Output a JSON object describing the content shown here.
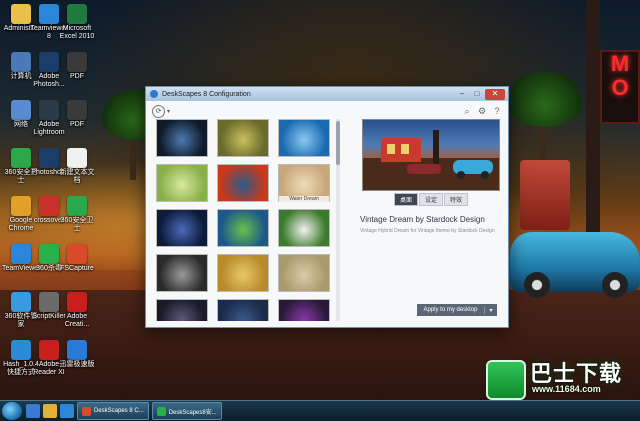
{
  "desktop_icons": [
    {
      "label": "Administr...",
      "icon": "folder-user-icon",
      "color": "#e8c04a"
    },
    {
      "label": "Teamviewer 8",
      "icon": "teamviewer-icon",
      "color": "#2a86d8"
    },
    {
      "label": "Microsoft Excel 2010",
      "icon": "excel-icon",
      "color": "#1e7a3e"
    },
    {
      "label": "计算机",
      "icon": "computer-icon",
      "color": "#4a78b8"
    },
    {
      "label": "Adobe Photosh...",
      "icon": "photoshop-icon",
      "color": "#1b3d6a"
    },
    {
      "label": "PDF",
      "icon": "pdf-icon",
      "color": "#3a3a3a"
    },
    {
      "label": "网络",
      "icon": "network-icon",
      "color": "#5a8ad0"
    },
    {
      "label": "Adobe Lightroom",
      "icon": "lightroom-icon",
      "color": "#2a3a48"
    },
    {
      "label": "PDF",
      "icon": "pdf-icon",
      "color": "#3a3a3a"
    },
    {
      "label": "360安全卫士",
      "icon": "360-icon",
      "color": "#2aa84a"
    },
    {
      "label": "Photosho...",
      "icon": "photoshop-icon",
      "color": "#1b3d6a"
    },
    {
      "label": "新建文本文档",
      "icon": "text-file-icon",
      "color": "#f0f0f0"
    },
    {
      "label": "Google Chrome",
      "icon": "chrome-icon",
      "color": "#e0a02a"
    },
    {
      "label": "crossover",
      "icon": "crossover-icon",
      "color": "#c8322a"
    },
    {
      "label": "360安全卫士",
      "icon": "360-icon",
      "color": "#2aa84a"
    },
    {
      "label": "TeamViewer",
      "icon": "teamviewer-icon",
      "color": "#2a86d8"
    },
    {
      "label": "360杀毒",
      "icon": "360-antivirus-icon",
      "color": "#2ab04a"
    },
    {
      "label": "FSCapture",
      "icon": "fscapture-icon",
      "color": "#d84a2a"
    },
    {
      "label": "360软件管家",
      "icon": "360-soft-icon",
      "color": "#3a9ae0"
    },
    {
      "label": "ScriptKiller",
      "icon": "script-icon",
      "color": "#6a6a6a"
    },
    {
      "label": "Adobe Creati...",
      "icon": "adobe-cc-icon",
      "color": "#c81e1e"
    },
    {
      "label": "Hash_1.0.4 快捷方式",
      "icon": "hash-icon",
      "color": "#2a8ad8"
    },
    {
      "label": "Adobe Reader XI",
      "icon": "reader-icon",
      "color": "#c81e1e"
    },
    {
      "label": "迅雷极速版",
      "icon": "thunder-icon",
      "color": "#2a7ad8"
    }
  ],
  "dialog": {
    "title": "DeskScapes 8 Configuration",
    "minimize": "–",
    "maximize": "□",
    "close": "✕",
    "thumbnails": [
      {
        "caption": "",
        "color": "#101a2a",
        "accent": "#4a7ab0"
      },
      {
        "caption": "",
        "color": "#6a6a2a",
        "accent": "#c8c060"
      },
      {
        "caption": "",
        "color": "#1a6ab0",
        "accent": "#8ac8f0"
      },
      {
        "caption": "",
        "color": "#8ab04a",
        "accent": "#d8e8a0"
      },
      {
        "caption": "",
        "color": "#c83a1a",
        "accent": "#2a5a8a"
      },
      {
        "caption": "Water Dream",
        "color": "#c8a87a",
        "accent": "#f0dcb8"
      },
      {
        "caption": "",
        "color": "#0e1a3a",
        "accent": "#4a6ab8"
      },
      {
        "caption": "",
        "color": "#1a5a8a",
        "accent": "#6ac04a"
      },
      {
        "caption": "",
        "color": "#3a7a2a",
        "accent": "#f0f0f0"
      },
      {
        "caption": "",
        "color": "#2a2a2a",
        "accent": "#9a9a9a"
      },
      {
        "caption": "",
        "color": "#b88a2a",
        "accent": "#e8c86a"
      },
      {
        "caption": "",
        "color": "#a89a6a",
        "accent": "#d8ccaa"
      },
      {
        "caption": "",
        "color": "#1a1a2a",
        "accent": "#5a5a7a"
      },
      {
        "caption": "",
        "color": "#1a2a4a",
        "accent": "#3a5a8a"
      },
      {
        "caption": "",
        "color": "#2a1a3a",
        "accent": "#8a3aa8"
      }
    ],
    "tabs": [
      "桌面",
      "设定",
      "特效"
    ],
    "active_tab": 0,
    "theme_title": "Vintage Dream by Stardock Design",
    "theme_desc": "Vintage Hybrid Dream for Vintage theme by Stardock Design",
    "apply_label": "Apply to my desktop",
    "apply_dropdown": "▾"
  },
  "taskbar": {
    "buttons": [
      {
        "label": "DeskScapes 8 C...",
        "color": "#d84a2a"
      },
      {
        "label": "DeskScapes8安...",
        "color": "#2ab04a"
      }
    ]
  },
  "watermark": {
    "brand": "巴士下载",
    "url": "www.11684.com"
  }
}
